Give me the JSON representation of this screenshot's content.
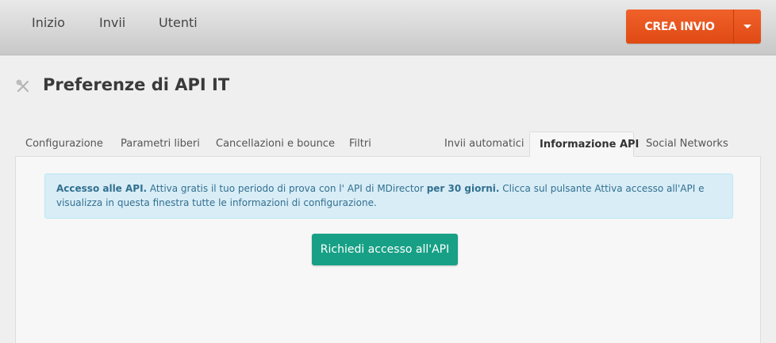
{
  "nav": {
    "items": [
      {
        "label": "Inizio"
      },
      {
        "label": "Invii"
      },
      {
        "label": "Utenti"
      }
    ],
    "create_label": "CREA INVIO",
    "create_caret_icon": "caret-down-icon"
  },
  "page": {
    "title": "Preferenze di API IT",
    "icon": "tools-icon"
  },
  "tabs": [
    {
      "label": "Configurazione",
      "active": false
    },
    {
      "label": "Parametri liberi",
      "active": false
    },
    {
      "label": "Cancellazioni e bounce",
      "active": false
    },
    {
      "label": "Filtri",
      "active": false
    },
    {
      "label": "Invii automatici",
      "active": false
    },
    {
      "label": "Informazione API",
      "active": true
    },
    {
      "label": "Social Networks",
      "active": false
    }
  ],
  "alert": {
    "strong1": "Accesso alle API.",
    "text1": " Attiva gratis il tuo periodo di prova con l' API di MDirector ",
    "strong2": "per 30 giorni.",
    "text2": " Clicca sul pulsante Attiva accesso all'API e visualizza in questa finestra tutte le informazioni di configurazione."
  },
  "request_button_label": "Richiedi accesso all'API",
  "colors": {
    "accent_orange": "#e85419",
    "accent_teal": "#17a086",
    "alert_bg": "#d9edf7",
    "alert_text": "#31708f"
  }
}
